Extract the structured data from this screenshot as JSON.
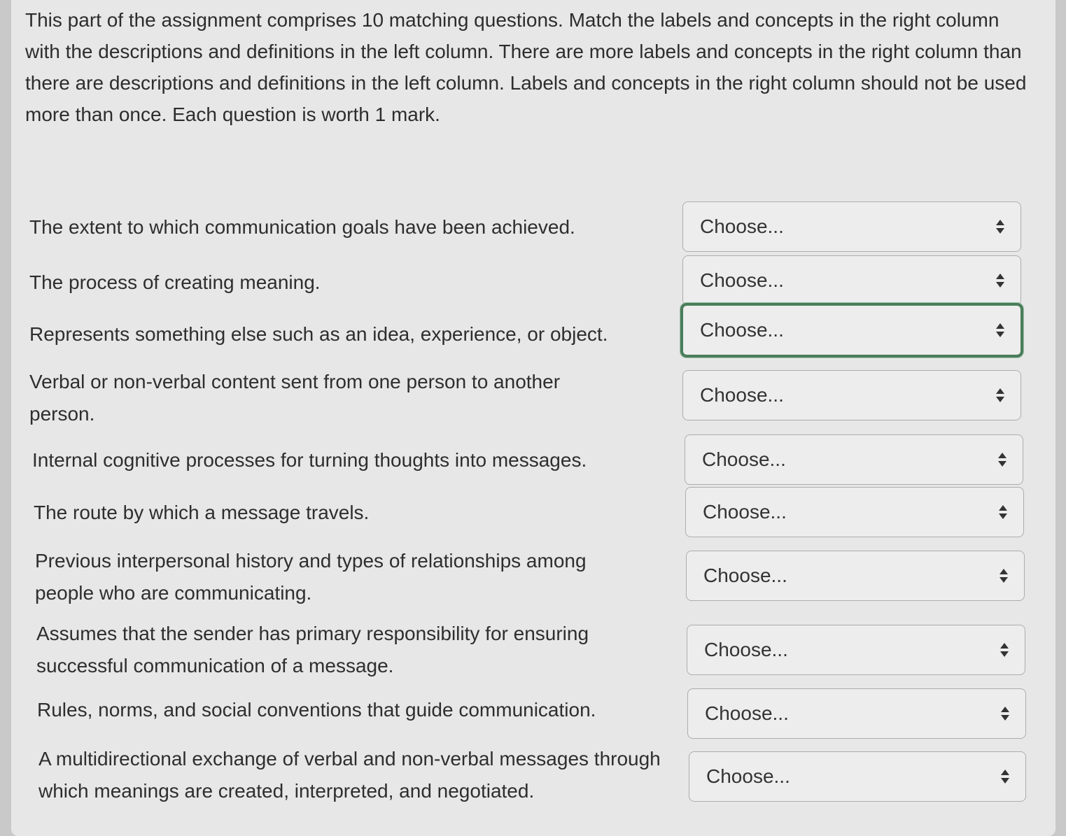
{
  "intro": "This part of the assignment comprises 10 matching questions. Match the labels and concepts in the right column with the descriptions and definitions in the left column. There are more labels and concepts in the right column than there are descriptions and definitions in the left column. Labels and concepts in the right column should not be used more than once. Each question is worth 1 mark.",
  "questions": [
    {
      "text": "The extent to which communication goals have been achieved.",
      "selected": "Choose..."
    },
    {
      "text": "The process of creating meaning.",
      "selected": "Choose..."
    },
    {
      "text": "Represents something else such as an idea, experience, or object.",
      "selected": "Choose..."
    },
    {
      "text": "Verbal or non-verbal content sent from one person to another person.",
      "selected": "Choose..."
    },
    {
      "text": "Internal cognitive processes for turning thoughts into messages.",
      "selected": "Choose..."
    },
    {
      "text": "The route by which a message travels.",
      "selected": "Choose..."
    },
    {
      "text": "Previous interpersonal history and types of relationships among people who are communicating.",
      "selected": "Choose..."
    },
    {
      "text": "Assumes that the sender has primary responsibility for ensuring successful communication of a message.",
      "selected": "Choose..."
    },
    {
      "text": "Rules, norms, and social conventions that guide communication.",
      "selected": "Choose..."
    },
    {
      "text": "A multidirectional exchange of verbal and non-verbal messages through which meanings are created, interpreted, and negotiated.",
      "selected": "Choose..."
    }
  ],
  "icons": {
    "select_arrows": "up-down-chevron-icon"
  },
  "colors": {
    "focus_border": "#4a7d5b",
    "text": "#2e2e2e",
    "panel": "#e7e7e7"
  }
}
